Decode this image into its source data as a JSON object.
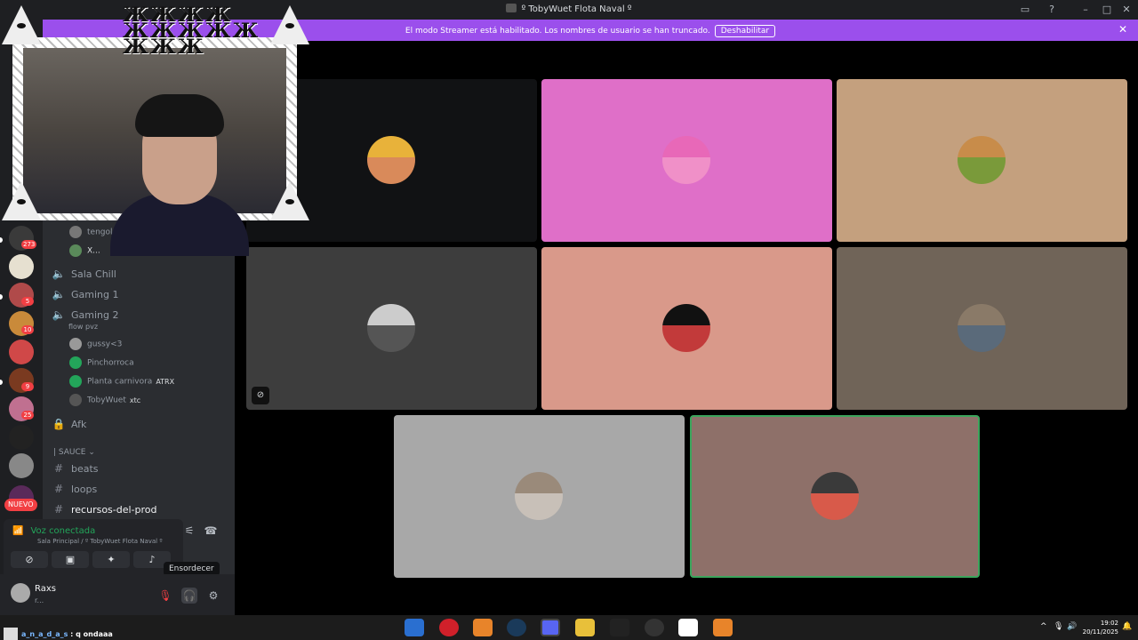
{
  "window": {
    "title": "º TobyWuet Flota Naval º"
  },
  "banner": {
    "text": "El modo Streamer está habilitado. Los nombres de usuario se han truncado.",
    "button": "Deshabilitar"
  },
  "rail": {
    "badges": [
      "273",
      "5",
      "10",
      "9",
      "25"
    ],
    "nuevo": "NUEVO"
  },
  "sidebar": {
    "users_top": [
      "tengolapocima",
      "X..."
    ],
    "voice_channels": [
      "Sala Chill",
      "Gaming 1",
      "Gaming 2"
    ],
    "gaming2_status": "flow pvz",
    "gaming2_users": [
      {
        "name": "gussy<3",
        "tag": ""
      },
      {
        "name": "Pinchorroca",
        "tag": ""
      },
      {
        "name": "Planta carnivora",
        "tag": "ATRX"
      },
      {
        "name": "TobyWuet",
        "tag": "xtc"
      }
    ],
    "afk": "Afk",
    "category": "| SAUCE",
    "text_channels": [
      "beats",
      "loops",
      "recursos-del-prod"
    ]
  },
  "voice": {
    "status": "Voz conectada",
    "location": "Sala Principal / º TobyWuet Flota Naval º",
    "tooltip": "Ensordecer"
  },
  "user": {
    "name": "Raxs",
    "status": "r..."
  },
  "taskbar": {
    "lyric": "q ondaaa",
    "time": "19:02",
    "date": "20/11/2025"
  },
  "colors": {
    "banner": "#9b4fec",
    "connected": "#23a55a",
    "badge": "#f23f43",
    "speaking": "#3ba55c"
  },
  "icons": [
    "search-icon",
    "help-icon",
    "close-icon",
    "speaker-icon",
    "hash-icon",
    "lock-icon",
    "signal-icon",
    "mute-icon",
    "headphones-icon",
    "gear-icon"
  ]
}
